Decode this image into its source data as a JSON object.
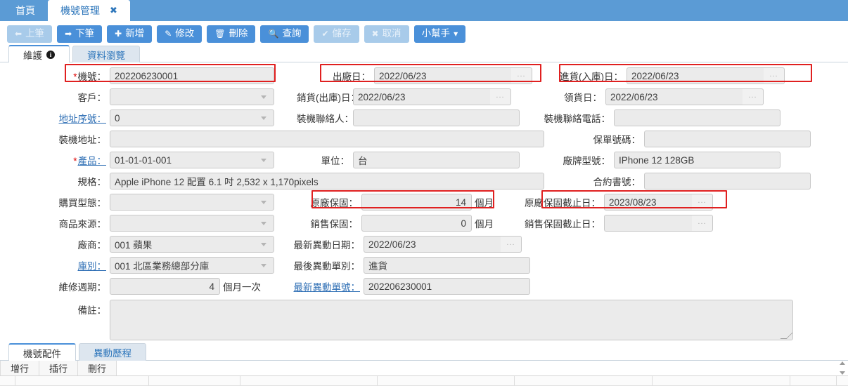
{
  "window": {
    "tabs": [
      {
        "label": "首頁",
        "active": false,
        "closable": false
      },
      {
        "label": "機號管理",
        "active": true,
        "closable": true,
        "close_icon": "close-x-icon"
      }
    ]
  },
  "toolbar": {
    "buttons": [
      {
        "label": "上筆",
        "icon": "arrow-left-icon",
        "glyph": "←",
        "disabled": true
      },
      {
        "label": "下筆",
        "icon": "arrow-right-icon",
        "glyph": "→",
        "disabled": false
      },
      {
        "label": "新增",
        "icon": "plus-icon",
        "glyph": "✚",
        "disabled": false
      },
      {
        "label": "修改",
        "icon": "pencil-icon",
        "glyph": "✎",
        "disabled": false
      },
      {
        "label": "刪除",
        "icon": "trash-icon",
        "glyph": "🗑",
        "disabled": false
      },
      {
        "label": "查詢",
        "icon": "search-icon",
        "glyph": "🔍",
        "disabled": false
      },
      {
        "label": "儲存",
        "icon": "check-icon",
        "glyph": "✔",
        "disabled": true
      },
      {
        "label": "取消",
        "icon": "cross-icon",
        "glyph": "✖",
        "disabled": true
      },
      {
        "label": "小幫手",
        "icon": "caret-down-icon",
        "glyph": "▾",
        "disabled": false,
        "icon_after": true
      }
    ]
  },
  "subtabs": [
    {
      "label": "維護",
      "active": true,
      "badge_icon": "info-icon",
      "badge": "i"
    },
    {
      "label": "資料瀏覽",
      "active": false
    }
  ],
  "form": {
    "machine_no": {
      "label": "機號：",
      "required": true,
      "value": "202206230001",
      "highlighted": true
    },
    "mfg_date": {
      "label": "出廠日：",
      "value": "2022/06/23",
      "picker": "...",
      "highlighted": true
    },
    "stock_in_date": {
      "label": "進貨(入庫)日：",
      "value": "2022/06/23",
      "picker": "...",
      "highlighted": true
    },
    "customer": {
      "label": "客戶：",
      "value": "",
      "dropdown": true
    },
    "sale_out_date": {
      "label": "銷貨(出庫)日：",
      "value": "2022/06/23",
      "picker": "..."
    },
    "pickup_date": {
      "label": "領貨日：",
      "value": "2022/06/23",
      "picker": "..."
    },
    "address_seq": {
      "label": "地址序號：",
      "link": true,
      "value": "0",
      "dropdown": true
    },
    "install_contact": {
      "label": "裝機聯絡人：",
      "value": ""
    },
    "install_phone": {
      "label": "裝機聯絡電話：",
      "value": ""
    },
    "install_address": {
      "label": "裝機地址：",
      "value": ""
    },
    "policy_no": {
      "label": "保單號碼：",
      "value": ""
    },
    "product": {
      "label": "產品：",
      "required": true,
      "link": true,
      "value": "01-01-01-001",
      "dropdown": true
    },
    "unit": {
      "label": "單位：",
      "value": "台"
    },
    "brand_model": {
      "label": "廠牌型號：",
      "value": "IPhone 12 128GB"
    },
    "spec": {
      "label": "規格：",
      "value": "Apple iPhone 12 配置 6.1 吋 2,532 x 1,170pixels"
    },
    "contract_no": {
      "label": "合約書號：",
      "value": ""
    },
    "purchase_type": {
      "label": "購買型態：",
      "value": "",
      "dropdown": true
    },
    "factory_warranty": {
      "label": "原廠保固：",
      "value": "14",
      "suffix": "個月",
      "highlighted": true
    },
    "factory_warranty_end": {
      "label": "原廠保固截止日：",
      "value": "2023/08/23",
      "picker": "...",
      "highlighted": true
    },
    "product_source": {
      "label": "商品來源：",
      "value": "",
      "dropdown": true
    },
    "sales_warranty": {
      "label": "銷售保固：",
      "value": "0",
      "suffix": "個月"
    },
    "sales_warranty_end": {
      "label": "銷售保固截止日：",
      "value": "",
      "picker": "..."
    },
    "vendor": {
      "label": "廠商：",
      "value": "001 蘋果",
      "dropdown": true
    },
    "last_change_date": {
      "label": "最新異動日期：",
      "value": "2022/06/23",
      "picker": "..."
    },
    "warehouse": {
      "label": "庫別：",
      "link": true,
      "value": "001 北區業務總部分庫",
      "dropdown": true
    },
    "last_change_type": {
      "label": "最後異動單別：",
      "value": "進貨"
    },
    "maint_cycle": {
      "label": "維修週期：",
      "value": "4",
      "suffix": "個月一次"
    },
    "last_change_no": {
      "label": "最新異動單號：",
      "link": true,
      "value": "202206230001"
    },
    "remarks": {
      "label": "備註：",
      "value": ""
    }
  },
  "bottom": {
    "tabs": [
      {
        "label": "機號配件",
        "active": true
      },
      {
        "label": "異動歷程",
        "active": false
      }
    ],
    "grid_buttons": [
      {
        "label": "增行"
      },
      {
        "label": "插行"
      },
      {
        "label": "刪行"
      }
    ],
    "scroll": {
      "up_icon": "scroll-up-arrow-icon",
      "down_icon": "scroll-down-arrow-icon"
    }
  },
  "colors": {
    "brand_blue": "#5b9bd5",
    "button_blue": "#4a90d9",
    "highlight_red": "#e02020",
    "field_bg": "#ebebeb",
    "link_blue": "#2f6fb5"
  }
}
